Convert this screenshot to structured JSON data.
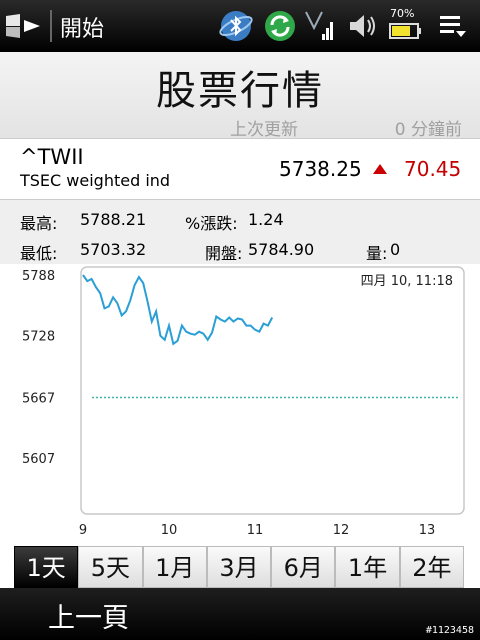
{
  "status_bar": {
    "start_label": "開始",
    "battery_percent": "70%",
    "icons": [
      "windows-logo-icon",
      "bluetooth-icon",
      "sync-icon",
      "signal-icon",
      "volume-icon",
      "battery-icon",
      "menu-icon"
    ]
  },
  "header": {
    "title": "股票行情",
    "last_update_label": "上次更新",
    "last_update_value": "0 分鐘前"
  },
  "quote": {
    "symbol": "^TWII",
    "name": "TSEC weighted ind",
    "price": "5738.25",
    "change": "70.45",
    "change_color": "#c40000"
  },
  "stats": {
    "high_label": "最高:",
    "high_value": "5788.21",
    "pct_label": "%漲跌:",
    "pct_value": "1.24",
    "low_label": "最低:",
    "low_value": "5703.32",
    "open_label": "開盤:",
    "open_value": "5784.90",
    "volume_label": "量:",
    "volume_value": "0"
  },
  "chart_data": {
    "type": "line",
    "timestamp_label": "四月 10, 11:18",
    "y_ticks": [
      "5788",
      "5728",
      "5667",
      "5607"
    ],
    "x_ticks": [
      "9",
      "10",
      "11",
      "12",
      "13"
    ],
    "ylim": [
      5546,
      5788
    ],
    "xlim": [
      9,
      13
    ],
    "reference_line": 5667,
    "line_color": "#2a9fd6",
    "reference_color": "#3fb8a8",
    "series": [
      {
        "x": [
          9.0,
          9.05,
          9.1,
          9.15,
          9.2,
          9.25,
          9.3,
          9.35,
          9.4,
          9.45,
          9.5,
          9.55,
          9.6,
          9.65,
          9.7,
          9.75,
          9.8,
          9.85,
          9.9,
          9.95,
          10.0,
          10.05,
          10.1,
          10.15,
          10.2,
          10.25,
          10.3,
          10.35,
          10.4,
          10.45,
          10.5,
          10.55,
          10.6,
          10.65,
          10.7,
          10.75,
          10.8,
          10.85,
          10.9,
          10.95,
          11.0,
          11.05,
          11.1,
          11.15,
          11.2
        ],
        "y": [
          5788,
          5782,
          5784,
          5776,
          5770,
          5755,
          5757,
          5766,
          5760,
          5748,
          5752,
          5763,
          5778,
          5786,
          5780,
          5762,
          5742,
          5752,
          5728,
          5724,
          5738,
          5720,
          5723,
          5738,
          5732,
          5730,
          5729,
          5732,
          5730,
          5724,
          5731,
          5747,
          5744,
          5742,
          5746,
          5742,
          5745,
          5744,
          5738,
          5738,
          5734,
          5732,
          5740,
          5738,
          5746
        ]
      }
    ]
  },
  "tabs": [
    "1天",
    "5天",
    "1月",
    "3月",
    "6月",
    "1年",
    "2年"
  ],
  "active_tab": 0,
  "bottom": {
    "back_label": "上一頁",
    "watermark": "#1123458"
  }
}
